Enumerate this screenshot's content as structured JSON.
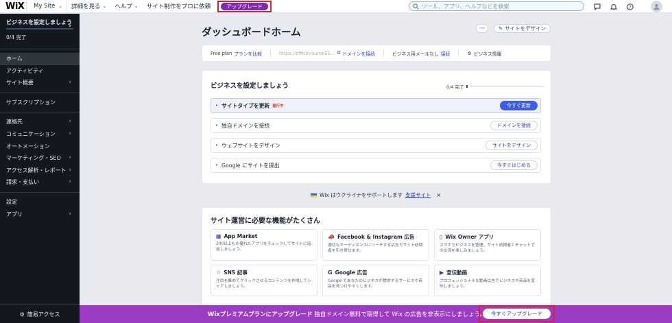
{
  "topbar": {
    "logo": "WiX",
    "site_name": "My Site",
    "menu": [
      {
        "label": "詳細を見る"
      },
      {
        "label": "ヘルプ"
      },
      {
        "label": "サイト制作をプロに依頼"
      }
    ],
    "upgrade_label": "アップグレード",
    "search_placeholder": "ツール、アプリ、ヘルプなどを検索",
    "icons": [
      "chat-icon",
      "bell-icon",
      "help-icon",
      "avatar"
    ]
  },
  "sidebar": {
    "setup_title": "ビジネスを設定しましょう",
    "progress_text": "0/4 完了",
    "items": [
      {
        "label": "ホーム",
        "active": true,
        "arrow": false
      },
      {
        "label": "アクティビティ",
        "arrow": false
      },
      {
        "label": "サイト概要",
        "arrow": true
      },
      {
        "label": "サブスクリプション",
        "arrow": false
      },
      {
        "label": "連絡先",
        "arrow": true
      },
      {
        "label": "コミュニケーション",
        "arrow": true
      },
      {
        "label": "オートメーション",
        "arrow": false
      },
      {
        "label": "マーケティング・SEO",
        "arrow": true
      },
      {
        "label": "アクセス解析・レポート",
        "arrow": true
      },
      {
        "label": "請求・支払い",
        "arrow": true
      },
      {
        "label": "設定",
        "arrow": false
      },
      {
        "label": "アプリ",
        "arrow": true
      }
    ],
    "quick_access": "簡易アクセス"
  },
  "main": {
    "title": "ダッシュボードホーム",
    "design_button": "サイトをデザイン",
    "plan_bar": {
      "plan": "Free plan",
      "compare": "プランを比較",
      "url": "https://officeyoume01...",
      "connect_domain": "ドメインを接続",
      "email_text": "ビジネス用メールなし",
      "email_link": "接続",
      "business_info": "ビジネス情報"
    },
    "setup": {
      "title": "ビジネスを設定しましょう",
      "progress": "0/4 完了",
      "progress_fraction": 0,
      "tasks": [
        {
          "label": "サイトタイプを更新",
          "status": "進行中",
          "button": "今すぐ更新",
          "primary": true
        },
        {
          "label": "独自ドメインを接続",
          "status": "",
          "button": "ドメインを接続",
          "primary": false
        },
        {
          "label": "ウェブサイトをデザイン",
          "status": "",
          "button": "サイトをデザイン",
          "primary": false
        },
        {
          "label": "Google にサイトを提出",
          "status": "",
          "button": "今すぐはじめる",
          "primary": false
        }
      ]
    },
    "ukraine": {
      "text": "Wix はウクライナをサポートします",
      "link": "支援サイト",
      "close": "×"
    },
    "features": {
      "title": "サイト運営に必要な機能がたくさん",
      "items": [
        {
          "title": "App Market",
          "icon": "app-market-icon",
          "desc": "300以上もの優れたアプリをチェックしてサイトに追加しましょう。"
        },
        {
          "title": "Facebook & Instagram 広告",
          "icon": "megaphone-icon",
          "desc": "適切なオーディエンスにリーチする広告でサイト訪問者を引き寄せます。"
        },
        {
          "title": "Wix Owner アプリ",
          "icon": "phone-icon",
          "desc": "スマホでビジネスを管理、サイト訪問者とチャットでの交流を楽しみましょう。"
        },
        {
          "title": "SNS 記事",
          "icon": "star-icon",
          "desc": "注目を集めてクリックさせるコンテンツを作成してシェアしましょう。"
        },
        {
          "title": "Google 広告",
          "icon": "google-icon",
          "desc": "Google であなたのビジネスが提供するサービスや商品を見つけやすくします。"
        },
        {
          "title": "宣伝動画",
          "icon": "video-icon",
          "desc": "プロフェッショナルな動画広告でビジネスや商品を宣伝しましょう。"
        }
      ]
    }
  },
  "banner": {
    "bold": "Wixプレミアムプランにアップグレード",
    "text": " 独自ドメイン無料で取得して Wix の広告を非表示にしましょう。",
    "button": "今すぐアップグレード"
  },
  "colors": {
    "accent": "#3d5ce6",
    "upgrade": "#8228a8",
    "banner": "#9c3cc4",
    "highlight": "#e0202a",
    "sidebar": "#13171e"
  }
}
